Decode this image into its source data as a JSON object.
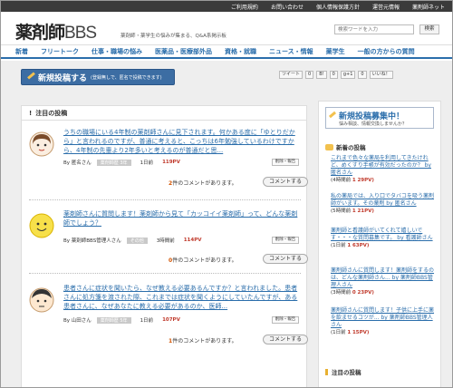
{
  "topbar": [
    "ご利用規約",
    "お問い合わせ",
    "個人情報保護方針",
    "運営元情報",
    "薬剤師ネット"
  ],
  "header": {
    "logo_main": "薬剤師",
    "logo_sub": "BBS",
    "tagline": "薬剤師・薬学生の悩みが集まる、Q&A系掲示板",
    "search_placeholder": "検索ワードを入力",
    "search_button": "検索"
  },
  "nav": [
    "新着",
    "フリートーク",
    "仕事・職場の悩み",
    "医薬品・医療部外品",
    "資格・就職",
    "ニュース・情報",
    "薬学生",
    "一般の方からの質問"
  ],
  "post_button": {
    "title": "新規投稿する",
    "sub": "(登録無しで、匿名で投稿できます)"
  },
  "social": [
    "ツイート",
    "0",
    "B!",
    "0",
    "g+1",
    "0",
    "いいね！"
  ],
  "featured": {
    "heading": "注目の投稿",
    "posts": [
      {
        "title": "うちの職場にいる4年制の薬剤師さんに見下されます。何かある度に「ゆとりだから」と言われるのですが、普通に考えると、こっちは6年勉強しているわけですから、4年制の先輩より2年多いと考えるのが普通だと思...",
        "by": "By 匿名さん",
        "category": "薬剤師歴 3年",
        "time": "1日前",
        "pv": "119PV",
        "report": "削除・報告",
        "comments_count": "2",
        "comments_text": "件のコメントがあります。",
        "comment_button": "コメントする"
      },
      {
        "title": "薬剤師さんに質問します！薬剤師から見て「カッコイイ薬剤師」って、どんな薬剤師でしょう？",
        "by": "By 薬剤師BBS管理人さん",
        "category": "その他",
        "time": "3時間前",
        "pv": "114PV",
        "report": "削除・報告",
        "comments_count": "0",
        "comments_text": "件のコメントがあります。",
        "comment_button": "コメントする"
      },
      {
        "title": "患者さんに症状を聞いたら、なぜ教える必要あるんですか？と言われました。患者さんに処方箋を渡された際、これまでは症状を聞くようにしていたんですが、ある患者さんに、なぜあなたに教える必要があるのか、医師...",
        "by": "By 山田さん",
        "category": "薬剤師歴 5年",
        "time": "1日前",
        "pv": "107PV",
        "report": "削除・報告",
        "comments_count": "1",
        "comments_text": "件のコメントがあります。",
        "comment_button": "コメントする"
      }
    ]
  },
  "sidebar": {
    "recruit_title": "新規投稿募集中！",
    "recruit_sub": "悩み相談、情報交換しませんか？",
    "new_heading": "新着の投稿",
    "new_posts": [
      {
        "link": "これまで色々な薬局を利用してきたけれど、めくすり手帳が有効だったのか？ by 匿名さん",
        "time": "(4時間前",
        "comments": "1",
        "pv": "29PV)"
      },
      {
        "link": "私の薬局では、入り口でタバコを吸う薬剤師がいます。その薬剤 by 匿名さん",
        "time": "(5時間前",
        "comments": "1",
        "pv": "21PV)"
      },
      {
        "link": "薬剤師と看護師がいてくれて嬉しいです・・・な質問募集です。 by 看護師さん",
        "time": "(1日前",
        "comments": "1",
        "pv": "63PV)"
      },
      {
        "link": "薬剤師さんに質問します！薬剤師をするのは、どんな薬剤師さん... by 薬剤師BBS管理人さん",
        "time": "(3時間前",
        "comments": "0",
        "pv": "23PV)"
      },
      {
        "link": "薬剤師さんに質問します！子供に上手に薬を飲ませるコツが... by 薬剤師BBS管理人さん",
        "time": "(1日前",
        "comments": "1",
        "pv": "15PV)"
      }
    ],
    "featured_heading": "注目の投稿"
  }
}
